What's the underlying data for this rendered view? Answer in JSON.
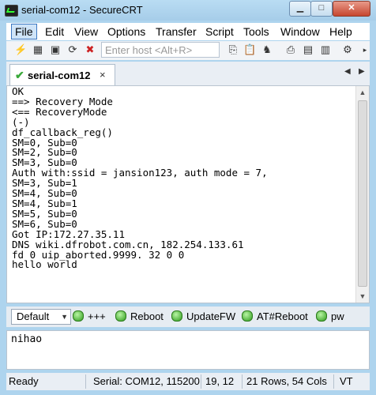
{
  "window": {
    "title": "serial-com12 - SecureCRT",
    "min": "▁",
    "max": "□",
    "close": "✕"
  },
  "menu": [
    "File",
    "Edit",
    "View",
    "Options",
    "Transfer",
    "Script",
    "Tools",
    "Window",
    "Help"
  ],
  "toolbar": {
    "host_placeholder": "Enter host <Alt+R>"
  },
  "tab": {
    "label": "serial-com12",
    "close": "×",
    "prev": "◀",
    "next": "▶"
  },
  "terminal": {
    "lines": [
      "OK",
      "==> Recovery Mode",
      "<== RecoveryMode",
      "(-)",
      "df_callback_reg()",
      "SM=0, Sub=0",
      "SM=2, Sub=0",
      "SM=3, Sub=0",
      "Auth with:ssid = jansion123, auth mode = 7,",
      "SM=3, Sub=1",
      "SM=4, Sub=0",
      "SM=4, Sub=1",
      "SM=5, Sub=0",
      "SM=6, Sub=0",
      "Got IP:172.27.35.11",
      "DNS wiki.dfrobot.com.cn, 182.254.133.61",
      "fd 0 uip_aborted.9999. 32 0 0",
      "hello world"
    ]
  },
  "button_bar": {
    "selected": "Default",
    "buttons": [
      "+++",
      "Reboot",
      "UpdateFW",
      "AT#Reboot",
      "pw"
    ]
  },
  "command_window": {
    "text": "nihao"
  },
  "status": {
    "ready": "Ready",
    "serial": "Serial: COM12, 115200",
    "cursor": "19,  12",
    "size": "21 Rows, 54 Cols",
    "term": "VT"
  }
}
